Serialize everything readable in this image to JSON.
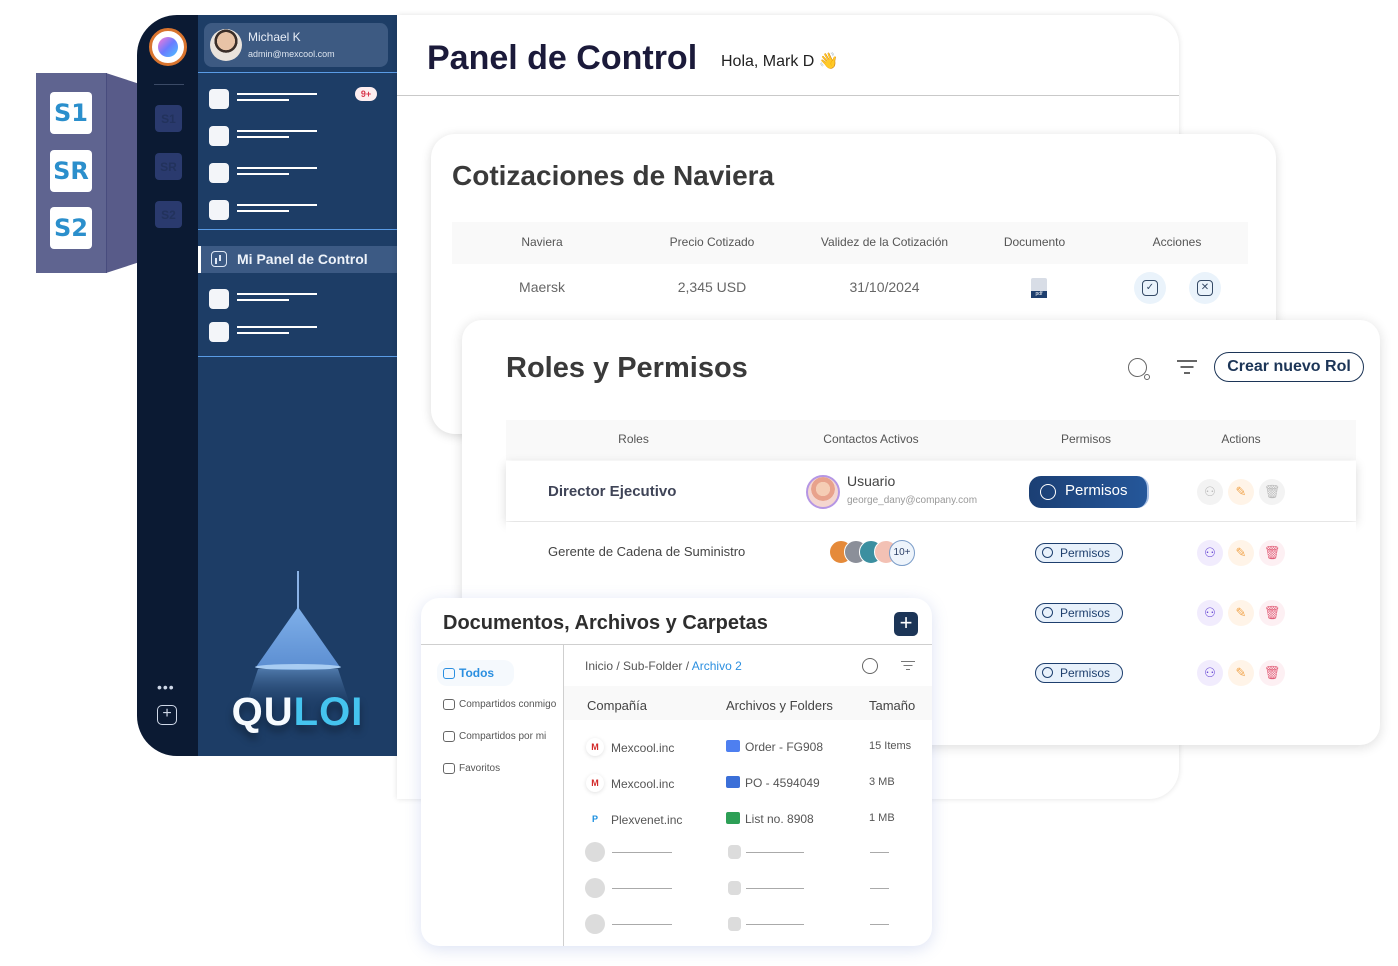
{
  "callout": {
    "badges": [
      "S1",
      "SR",
      "S2"
    ]
  },
  "rail": {
    "badges": [
      "S1",
      "SR",
      "S2"
    ],
    "more_label": "•••",
    "add_label": "+"
  },
  "sidebar": {
    "user": {
      "name": "Michael K",
      "email": "admin@mexcool.com"
    },
    "notification_badge": "9+",
    "active_item": "Mi Panel de Control",
    "brand": {
      "part1": "QU",
      "part2": "LOI"
    }
  },
  "main": {
    "title": "Panel de Control",
    "greeting": "Hola, Mark D 👋"
  },
  "quotes": {
    "title": "Cotizaciones de Naviera",
    "columns": [
      "Naviera",
      "Precio Cotizado",
      "Validez de la Cotización",
      "Documento",
      "Acciones"
    ],
    "rows": [
      {
        "carrier": "Maersk",
        "price": "2,345 USD",
        "validity": "31/10/2024",
        "document": "pdf"
      }
    ],
    "actions": {
      "approve": "✓",
      "reject": "✕"
    }
  },
  "roles": {
    "title": "Roles y Permisos",
    "new_button": "Crear nuevo Rol",
    "columns": [
      "Roles",
      "Contactos Activos",
      "Permisos",
      "Actions"
    ],
    "rows": [
      {
        "role": "Director Ejecutivo",
        "contact_name": "Usuario",
        "contact_email": "george_dany@company.com",
        "permission": "Permisos"
      },
      {
        "role": "Gerente de Cadena de Suministro",
        "contacts_more": "10+",
        "permission": "Permisos"
      },
      {
        "role": "",
        "permission": "Permisos"
      },
      {
        "role": "",
        "permission": "Permisos"
      }
    ]
  },
  "docs": {
    "title": "Documentos, Archivos y Carpetas",
    "add_label": "+",
    "nav": [
      "Todos",
      "Compartidos conmigo",
      "Compartidos por mi",
      "Favoritos"
    ],
    "breadcrumb": {
      "home": "Inicio",
      "sub": "Sub-Folder",
      "current": "Archivo 2",
      "sep": " / "
    },
    "columns": [
      "Compañía",
      "Archivos y Folders",
      "Tamaño"
    ],
    "rows": [
      {
        "company": "Mexcool.inc",
        "file": "Order - FG908",
        "size": "15 Items",
        "type": "folder"
      },
      {
        "company": "Mexcool.inc",
        "file": "PO - 4594049",
        "size": "3 MB",
        "type": "word"
      },
      {
        "company": "Plexvenet.inc",
        "file": "List no. 8908",
        "size": "1 MB",
        "type": "excel"
      }
    ]
  },
  "colors": {
    "navy": "#1d3d66",
    "rail": "#0b1a33",
    "accent": "#2b8fe0",
    "brand_cyan": "#45c4ef"
  }
}
